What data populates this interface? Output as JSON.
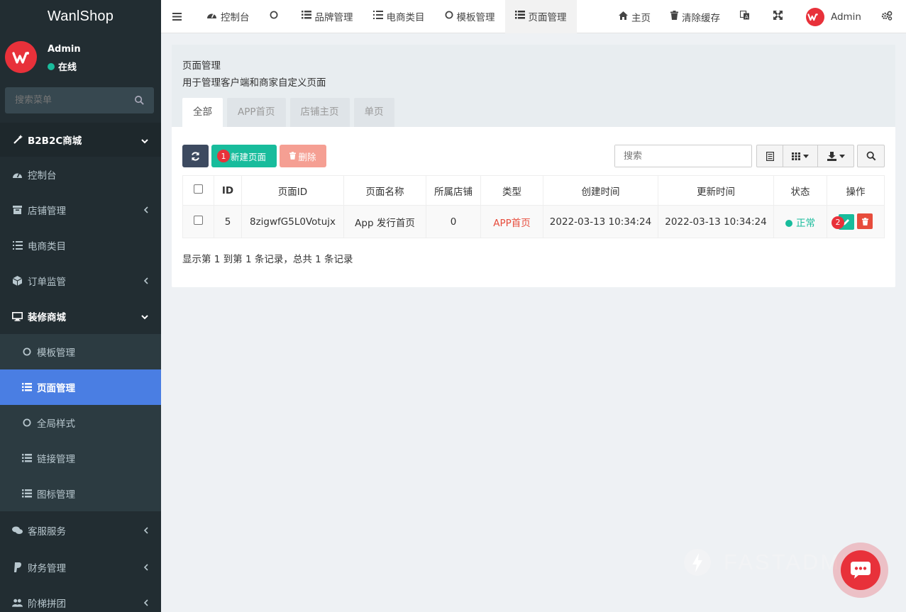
{
  "sidebar": {
    "brand": "WanlShop",
    "user_name": "Admin",
    "user_status": "在线",
    "search_placeholder": "搜索菜单",
    "items": [
      {
        "label": "B2B2C商城",
        "icon": "magic-wand-icon"
      },
      {
        "label": "控制台",
        "icon": "dashboard-icon"
      },
      {
        "label": "店铺管理",
        "icon": "archive-icon"
      },
      {
        "label": "电商类目",
        "icon": "list-ol-icon"
      },
      {
        "label": "订单监管",
        "icon": "cube-icon"
      },
      {
        "label": "装修商城",
        "icon": "desktop-icon"
      },
      {
        "label": "模板管理",
        "icon": "circle-icon"
      },
      {
        "label": "页面管理",
        "icon": "list-icon"
      },
      {
        "label": "全局样式",
        "icon": "circle-icon"
      },
      {
        "label": "链接管理",
        "icon": "list-icon"
      },
      {
        "label": "图标管理",
        "icon": "list-icon"
      },
      {
        "label": "客服服务",
        "icon": "comments-icon"
      },
      {
        "label": "财务管理",
        "icon": "paypal-icon"
      },
      {
        "label": "阶梯拼团",
        "icon": "users-icon"
      }
    ]
  },
  "topnav": {
    "tabs": [
      {
        "label": "控制台",
        "icon": "dashboard-icon"
      },
      {
        "label": "",
        "icon": "circle-icon"
      },
      {
        "label": "品牌管理",
        "icon": "list-icon"
      },
      {
        "label": "电商类目",
        "icon": "list-ol-icon"
      },
      {
        "label": "模板管理",
        "icon": "circle-icon"
      },
      {
        "label": "页面管理",
        "icon": "list-icon"
      }
    ],
    "home": "主页",
    "clear_cache": "清除缓存",
    "admin": "Admin"
  },
  "panel": {
    "title": "页面管理",
    "desc": "用于管理客户端和商家自定义页面",
    "tabs": [
      "全部",
      "APP首页",
      "店铺主页",
      "单页"
    ]
  },
  "toolbar": {
    "add_label": "新建页面",
    "delete_label": "删除",
    "badge1": "1",
    "badge2": "2",
    "search_placeholder": "搜索"
  },
  "table": {
    "headers": [
      "ID",
      "页面ID",
      "页面名称",
      "所属店铺",
      "类型",
      "创建时间",
      "更新时间",
      "状态",
      "操作"
    ],
    "rows": [
      {
        "id": "5",
        "page_id": "8zigwfG5L0Votujx",
        "name": "App 发行首页",
        "shop": "0",
        "type": "APP首页",
        "created": "2022-03-13 10:34:24",
        "updated": "2022-03-13 10:34:24",
        "status": "正常"
      }
    ]
  },
  "pager": {
    "info": "显示第 1 到第 1 条记录，总共 1 条记录"
  },
  "watermark": "FASTADMIN",
  "colors": {
    "accent": "#4a7ee3",
    "success": "#18bc9c",
    "danger": "#e74c3c",
    "brand": "#e8313a",
    "sidebar": "#222d32"
  }
}
